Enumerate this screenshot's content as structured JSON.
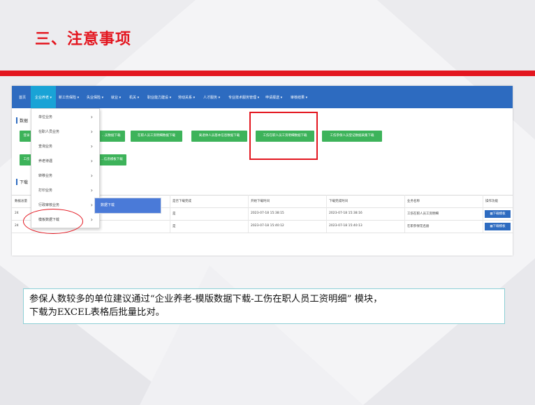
{
  "slide": {
    "title": "三、注意事项",
    "note_line1": "参保人数较多的单位建议通过“企业养老-模版数据下载-工伤在职人员工资明细” 模块，",
    "note_line2": "下载为EXCEL表格后批量比对。"
  },
  "nav": {
    "items": [
      "首页",
      "企业养老 ▾",
      "新工伤保险 ▾",
      "失业保险 ▾",
      "就业 ▾",
      "机关 ▾",
      "职业能力建设 ▾",
      "劳动关系 ▾",
      "人才服务 ▾",
      "专业技术服务管理 ▾",
      "申请报送 ▾",
      "审核结果 ▾"
    ]
  },
  "dropdown": {
    "items": [
      "单位业务",
      "在职人员业务",
      "查询业务",
      "养老待遇",
      "转移业务",
      "打印业务",
      "行政审核业务",
      "模板数据下载"
    ],
    "arrow": "›",
    "submenu_label": "数据下载"
  },
  "sections": {
    "data_label": "数据",
    "download_label": "下载"
  },
  "buttons": {
    "row1": [
      "登录",
      "…员数据下载",
      "在职人员工资明细数据下载",
      "离退休人员基本信息数据下载",
      "工伤在职人员工资明细数据下载",
      "工伤参保人员登记数据采集下载"
    ],
    "row2": [
      "工伤",
      "…信息模板下载"
    ]
  },
  "table": {
    "headers": [
      "数据总量",
      "是否下载完成",
      "开始下载时间",
      "下载完成时间",
      "业务名称",
      "操作功能"
    ],
    "rows": [
      {
        "count": "24",
        "done": "是",
        "start": "2023-07-18 15:38:15",
        "end": "2023-07-18 15:38:16",
        "name": "工伤在职人员工资明细",
        "action": "▦下载模板"
      },
      {
        "count": "24",
        "done": "是",
        "start": "2023-07-18 15:40:12",
        "end": "2023-07-18 15:40:13",
        "name": "在职参保花名册",
        "action": "▦下载模板"
      }
    ]
  },
  "colors": {
    "accent_red": "#e3161f",
    "nav_blue": "#2d6bc0",
    "active_nav": "#19a3d6",
    "button_green": "#3db35a",
    "submenu_blue": "#4a7ad8"
  }
}
